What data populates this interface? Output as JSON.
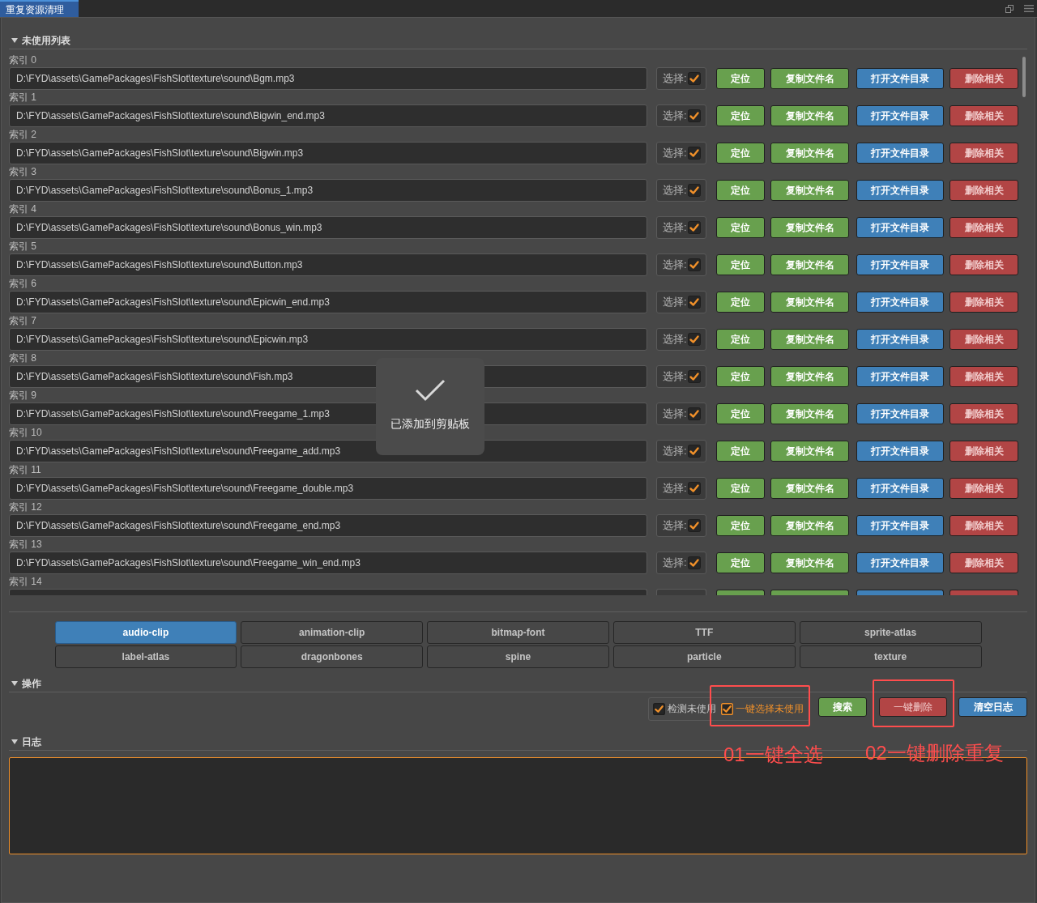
{
  "window": {
    "tabs": [
      {
        "label": "重复资源清理",
        "selected": true
      }
    ]
  },
  "unused_section": {
    "title": "未使用列表",
    "expanded": true,
    "rows": [
      {
        "label": "索引 0",
        "path": "D:\\FYD\\assets\\GamePackages\\FishSlot\\texture\\sound\\Bgm.mp3",
        "select_label": "选择:",
        "checked": true,
        "buttons": [
          {
            "kind": "locate",
            "label": "定位"
          },
          {
            "kind": "copy-name",
            "label": "复制文件名"
          },
          {
            "kind": "open-folder",
            "label": "打开文件目录"
          },
          {
            "kind": "delete",
            "label": "删除相关"
          }
        ]
      },
      {
        "label": "索引 1",
        "path": "D:\\FYD\\assets\\GamePackages\\FishSlot\\texture\\sound\\Bigwin_end.mp3",
        "select_label": "选择:",
        "checked": true,
        "buttons": [
          {
            "kind": "locate",
            "label": "定位"
          },
          {
            "kind": "copy-name",
            "label": "复制文件名"
          },
          {
            "kind": "open-folder",
            "label": "打开文件目录"
          },
          {
            "kind": "delete",
            "label": "删除相关"
          }
        ]
      },
      {
        "label": "索引 2",
        "path": "D:\\FYD\\assets\\GamePackages\\FishSlot\\texture\\sound\\Bigwin.mp3",
        "select_label": "选择:",
        "checked": true,
        "buttons": [
          {
            "kind": "locate",
            "label": "定位"
          },
          {
            "kind": "copy-name",
            "label": "复制文件名"
          },
          {
            "kind": "open-folder",
            "label": "打开文件目录"
          },
          {
            "kind": "delete",
            "label": "删除相关"
          }
        ]
      },
      {
        "label": "索引 3",
        "path": "D:\\FYD\\assets\\GamePackages\\FishSlot\\texture\\sound\\Bonus_1.mp3",
        "select_label": "选择:",
        "checked": true,
        "buttons": [
          {
            "kind": "locate",
            "label": "定位"
          },
          {
            "kind": "copy-name",
            "label": "复制文件名"
          },
          {
            "kind": "open-folder",
            "label": "打开文件目录"
          },
          {
            "kind": "delete",
            "label": "删除相关"
          }
        ]
      },
      {
        "label": "索引 4",
        "path": "D:\\FYD\\assets\\GamePackages\\FishSlot\\texture\\sound\\Bonus_win.mp3",
        "select_label": "选择:",
        "checked": true,
        "buttons": [
          {
            "kind": "locate",
            "label": "定位"
          },
          {
            "kind": "copy-name",
            "label": "复制文件名"
          },
          {
            "kind": "open-folder",
            "label": "打开文件目录"
          },
          {
            "kind": "delete",
            "label": "删除相关"
          }
        ]
      },
      {
        "label": "索引 5",
        "path": "D:\\FYD\\assets\\GamePackages\\FishSlot\\texture\\sound\\Button.mp3",
        "select_label": "选择:",
        "checked": true,
        "buttons": [
          {
            "kind": "locate",
            "label": "定位"
          },
          {
            "kind": "copy-name",
            "label": "复制文件名"
          },
          {
            "kind": "open-folder",
            "label": "打开文件目录"
          },
          {
            "kind": "delete",
            "label": "删除相关"
          }
        ]
      },
      {
        "label": "索引 6",
        "path": "D:\\FYD\\assets\\GamePackages\\FishSlot\\texture\\sound\\Epicwin_end.mp3",
        "select_label": "选择:",
        "checked": true,
        "buttons": [
          {
            "kind": "locate",
            "label": "定位"
          },
          {
            "kind": "copy-name",
            "label": "复制文件名"
          },
          {
            "kind": "open-folder",
            "label": "打开文件目录"
          },
          {
            "kind": "delete",
            "label": "删除相关"
          }
        ]
      },
      {
        "label": "索引 7",
        "path": "D:\\FYD\\assets\\GamePackages\\FishSlot\\texture\\sound\\Epicwin.mp3",
        "select_label": "选择:",
        "checked": true,
        "buttons": [
          {
            "kind": "locate",
            "label": "定位"
          },
          {
            "kind": "copy-name",
            "label": "复制文件名"
          },
          {
            "kind": "open-folder",
            "label": "打开文件目录"
          },
          {
            "kind": "delete",
            "label": "删除相关"
          }
        ]
      },
      {
        "label": "索引 8",
        "path": "D:\\FYD\\assets\\GamePackages\\FishSlot\\texture\\sound\\Fish.mp3",
        "select_label": "选择:",
        "checked": true,
        "buttons": [
          {
            "kind": "locate",
            "label": "定位"
          },
          {
            "kind": "copy-name",
            "label": "复制文件名"
          },
          {
            "kind": "open-folder",
            "label": "打开文件目录"
          },
          {
            "kind": "delete",
            "label": "删除相关"
          }
        ]
      },
      {
        "label": "索引 9",
        "path": "D:\\FYD\\assets\\GamePackages\\FishSlot\\texture\\sound\\Freegame_1.mp3",
        "select_label": "选择:",
        "checked": true,
        "buttons": [
          {
            "kind": "locate",
            "label": "定位"
          },
          {
            "kind": "copy-name",
            "label": "复制文件名"
          },
          {
            "kind": "open-folder",
            "label": "打开文件目录"
          },
          {
            "kind": "delete",
            "label": "删除相关"
          }
        ]
      },
      {
        "label": "索引 10",
        "path": "D:\\FYD\\assets\\GamePackages\\FishSlot\\texture\\sound\\Freegame_add.mp3",
        "select_label": "选择:",
        "checked": true,
        "buttons": [
          {
            "kind": "locate",
            "label": "定位"
          },
          {
            "kind": "copy-name",
            "label": "复制文件名"
          },
          {
            "kind": "open-folder",
            "label": "打开文件目录"
          },
          {
            "kind": "delete",
            "label": "删除相关"
          }
        ]
      },
      {
        "label": "索引 11",
        "path": "D:\\FYD\\assets\\GamePackages\\FishSlot\\texture\\sound\\Freegame_double.mp3",
        "select_label": "选择:",
        "checked": true,
        "buttons": [
          {
            "kind": "locate",
            "label": "定位"
          },
          {
            "kind": "copy-name",
            "label": "复制文件名"
          },
          {
            "kind": "open-folder",
            "label": "打开文件目录"
          },
          {
            "kind": "delete",
            "label": "删除相关"
          }
        ]
      },
      {
        "label": "索引 12",
        "path": "D:\\FYD\\assets\\GamePackages\\FishSlot\\texture\\sound\\Freegame_end.mp3",
        "select_label": "选择:",
        "checked": true,
        "buttons": [
          {
            "kind": "locate",
            "label": "定位"
          },
          {
            "kind": "copy-name",
            "label": "复制文件名"
          },
          {
            "kind": "open-folder",
            "label": "打开文件目录"
          },
          {
            "kind": "delete",
            "label": "删除相关"
          }
        ]
      },
      {
        "label": "索引 13",
        "path": "D:\\FYD\\assets\\GamePackages\\FishSlot\\texture\\sound\\Freegame_win_end.mp3",
        "select_label": "选择:",
        "checked": true,
        "buttons": [
          {
            "kind": "locate",
            "label": "定位"
          },
          {
            "kind": "copy-name",
            "label": "复制文件名"
          },
          {
            "kind": "open-folder",
            "label": "打开文件目录"
          },
          {
            "kind": "delete",
            "label": "删除相关"
          }
        ]
      },
      {
        "label": "索引 14",
        "buttons": [
          {
            "kind": "locate"
          },
          {
            "kind": "copy-name"
          },
          {
            "kind": "open-folder"
          },
          {
            "kind": "delete"
          }
        ]
      }
    ]
  },
  "toast": {
    "message": "已添加到剪贴板"
  },
  "asset_types": [
    {
      "label": "audio-clip",
      "selected": true
    },
    {
      "label": "animation-clip",
      "selected": false
    },
    {
      "label": "bitmap-font",
      "selected": false
    },
    {
      "label": "TTF",
      "selected": false
    },
    {
      "label": "sprite-atlas",
      "selected": false
    },
    {
      "label": "label-atlas",
      "selected": false
    },
    {
      "label": "dragonbones",
      "selected": false
    },
    {
      "label": "spine",
      "selected": false
    },
    {
      "label": "particle",
      "selected": false
    },
    {
      "label": "texture",
      "selected": false
    }
  ],
  "operations_section": {
    "title": "操作",
    "expanded": true,
    "options": [
      {
        "label": "检测未使用",
        "checked": true,
        "focused": false
      },
      {
        "label": "一键选择未使用",
        "checked": true,
        "focused": true
      }
    ],
    "buttons": [
      {
        "kind": "search",
        "label": "搜索"
      },
      {
        "kind": "delete-all",
        "label": "一键删除"
      },
      {
        "kind": "clear",
        "label": "清空日志"
      }
    ]
  },
  "log_section": {
    "title": "日志",
    "expanded": true,
    "focused": true
  },
  "annotations": [
    {
      "label": "01一键全选"
    },
    {
      "label": "02一键删除重复"
    }
  ]
}
